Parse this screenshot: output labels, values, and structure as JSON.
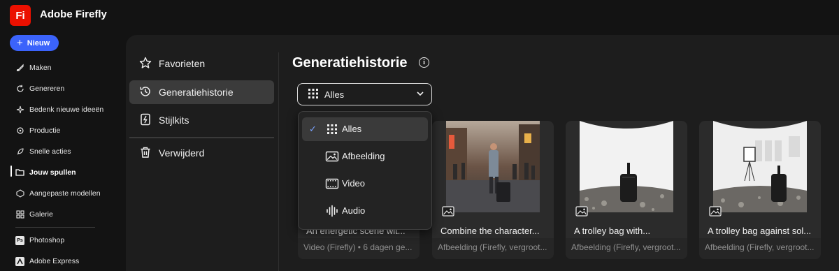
{
  "app": {
    "logo_text": "Fi",
    "title": "Adobe Firefly",
    "brand_color": "#eb1000"
  },
  "new_button": {
    "label": "Nieuw",
    "color": "#3b63fb"
  },
  "rail": {
    "items": [
      {
        "label": "Maken",
        "icon": "paintbrush-icon"
      },
      {
        "label": "Genereren",
        "icon": "refresh-icon"
      },
      {
        "label": "Bedenk nieuwe ideeën",
        "icon": "sparkle-icon"
      },
      {
        "label": "Productie",
        "icon": "production-icon"
      },
      {
        "label": "Snelle acties",
        "icon": "rocket-icon"
      },
      {
        "label": "Jouw spullen",
        "icon": "folder-icon",
        "active": true
      },
      {
        "label": "Aangepaste modellen",
        "icon": "models-icon"
      },
      {
        "label": "Galerie",
        "icon": "gallery-icon"
      }
    ],
    "apps": [
      {
        "label": "Photoshop",
        "icon": "photoshop-icon"
      },
      {
        "label": "Adobe Express",
        "icon": "express-icon"
      }
    ]
  },
  "nav": {
    "items": [
      {
        "label": "Favorieten",
        "icon": "star-icon"
      },
      {
        "label": "Generatiehistorie",
        "icon": "history-icon",
        "active": true
      },
      {
        "label": "Stijlkits",
        "icon": "stylekit-icon"
      },
      {
        "label": "Verwijderd",
        "icon": "trash-icon"
      }
    ]
  },
  "main": {
    "title": "Generatiehistorie"
  },
  "filter": {
    "selected": "Alles",
    "options": [
      {
        "label": "Alles",
        "icon": "grid-icon",
        "selected": true
      },
      {
        "label": "Afbeelding",
        "icon": "image-icon"
      },
      {
        "label": "Video",
        "icon": "video-icon"
      },
      {
        "label": "Audio",
        "icon": "audio-icon"
      }
    ]
  },
  "cards": [
    {
      "title": "An energetic scene wit...",
      "meta": "Video (Firefly) • 6 dagen ge..."
    },
    {
      "title": "Combine the character...",
      "meta": "Afbeelding (Firefly, vergroot...",
      "type_icon": "image-icon"
    },
    {
      "title": "A trolley bag with...",
      "meta": "Afbeelding (Firefly, vergroot...",
      "type_icon": "image-icon"
    },
    {
      "title": "A trolley bag against sol...",
      "meta": "Afbeelding (Firefly, vergroot...",
      "type_icon": "image-icon"
    }
  ]
}
